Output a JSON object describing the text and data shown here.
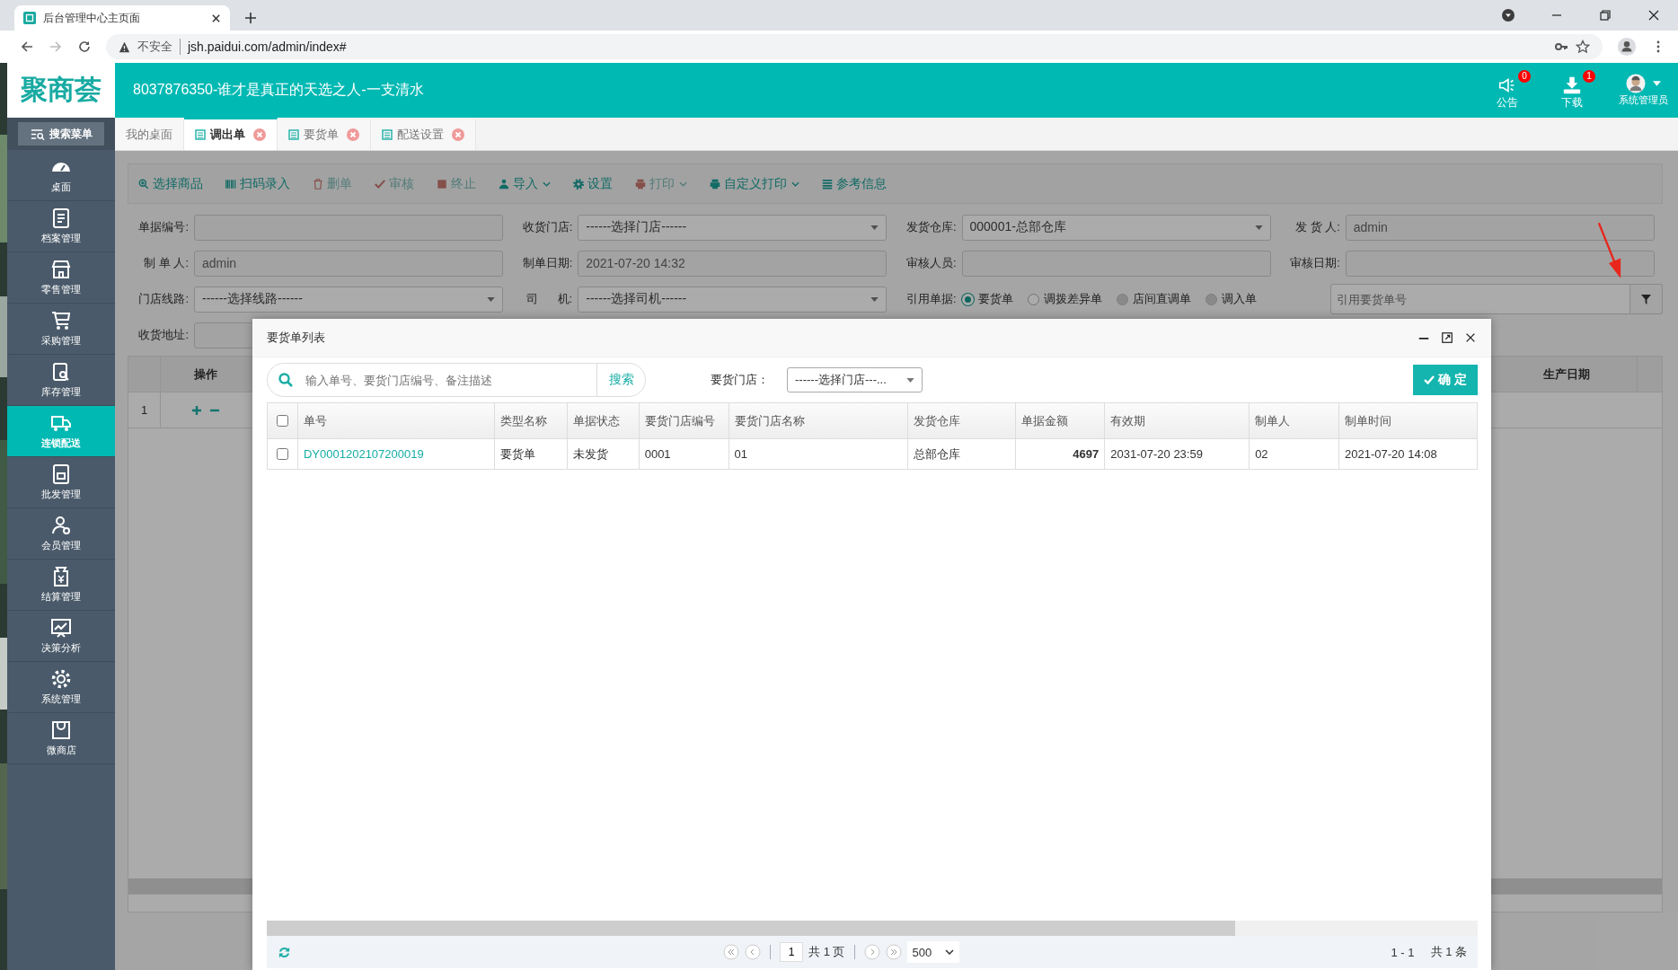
{
  "browser": {
    "tab_title": "后台管理中心主页面",
    "security": "不安全",
    "url": "jsh.paidui.com/admin/index#"
  },
  "header": {
    "logo": "聚商荟",
    "title": "8037876350-谁才是真正的天选之人-一支清水",
    "user": "系统管理员",
    "actions": [
      {
        "label": "公告",
        "badge": "0"
      },
      {
        "label": "下载",
        "badge": "1"
      }
    ]
  },
  "sidebar": {
    "search": "搜索菜单",
    "items": [
      {
        "label": "桌面",
        "selected": false
      },
      {
        "label": "档案管理",
        "selected": false
      },
      {
        "label": "零售管理",
        "selected": false
      },
      {
        "label": "采购管理",
        "selected": false
      },
      {
        "label": "库存管理",
        "selected": false
      },
      {
        "label": "连锁配送",
        "selected": true
      },
      {
        "label": "批发管理",
        "selected": false
      },
      {
        "label": "会员管理",
        "selected": false
      },
      {
        "label": "结算管理",
        "selected": false
      },
      {
        "label": "决策分析",
        "selected": false
      },
      {
        "label": "系统管理",
        "selected": false
      },
      {
        "label": "微商店",
        "selected": false
      }
    ]
  },
  "tabs": [
    {
      "label": "我的桌面",
      "selected": false,
      "closable": false
    },
    {
      "label": "调出单",
      "selected": true,
      "closable": true
    },
    {
      "label": "要货单",
      "selected": false,
      "closable": true
    },
    {
      "label": "配送设置",
      "selected": false,
      "closable": true
    }
  ],
  "toolbar": [
    {
      "label": "选择商品",
      "disabled": false,
      "dropdown": false
    },
    {
      "label": "扫码录入",
      "disabled": false,
      "dropdown": false
    },
    {
      "label": "删单",
      "disabled": true,
      "dropdown": false
    },
    {
      "label": "审核",
      "disabled": true,
      "dropdown": false
    },
    {
      "label": "终止",
      "disabled": true,
      "dropdown": false
    },
    {
      "label": "导入",
      "disabled": false,
      "dropdown": true
    },
    {
      "label": "设置",
      "disabled": false,
      "dropdown": false
    },
    {
      "label": "打印",
      "disabled": true,
      "dropdown": true
    },
    {
      "label": "自定义打印",
      "disabled": false,
      "dropdown": true
    },
    {
      "label": "参考信息",
      "disabled": false,
      "dropdown": false
    }
  ],
  "form": {
    "grid": [
      {
        "label": "单据编号:",
        "kind": "input"
      },
      {
        "label": "收货门店:",
        "kind": "select",
        "value": "------选择门店------"
      },
      {
        "label": "发货仓库:",
        "kind": "select",
        "value": "000001-总部仓库"
      },
      {
        "label": "发 货 人:",
        "kind": "input",
        "value": "admin"
      },
      {
        "label": "制 单 人:",
        "kind": "input",
        "value": "admin"
      },
      {
        "label": "制单日期:",
        "kind": "input",
        "value": "2021-07-20 14:32"
      },
      {
        "label": "审核人员:",
        "kind": "input"
      },
      {
        "label": "审核日期:",
        "kind": "input"
      },
      {
        "label": "门店线路:",
        "kind": "select",
        "value": "------选择线路------"
      },
      {
        "label": "司      机:",
        "kind": "select",
        "value": "------选择司机------"
      }
    ],
    "reference": {
      "label": "引用单据:",
      "placeholder": "引用要货单号",
      "options": [
        {
          "label": "要货单",
          "selected": true,
          "disabled": false
        },
        {
          "label": "调拨差异单",
          "selected": false,
          "disabled": false
        },
        {
          "label": "店间直调单",
          "selected": false,
          "disabled": true
        },
        {
          "label": "调入单",
          "selected": false,
          "disabled": true
        }
      ]
    },
    "address": {
      "label": "收货地址:"
    }
  },
  "table": {
    "columns": [
      "操作",
      "生产日期"
    ],
    "rows": [
      {
        "index": "1"
      }
    ]
  },
  "modal": {
    "title": "要货单列表",
    "search_placeholder": "输入单号、要货门店编号、备注描述",
    "search_button": "搜索",
    "store_label": "要货门店：",
    "store_value": "------选择门店---...",
    "confirm": "确 定",
    "all_checked": false,
    "columns": [
      "单号",
      "类型名称",
      "单据状态",
      "要货门店编号",
      "要货门店名称",
      "发货仓库",
      "单据金额",
      "有效期",
      "制单人",
      "制单时间"
    ],
    "rows": [
      {
        "checked": false,
        "cells": [
          "DY0001202107200019",
          "要货单",
          "未发货",
          "0001",
          "01",
          "总部仓库",
          "4697",
          "2031-07-20 23:59",
          "02",
          "2021-07-20 14:08"
        ]
      }
    ],
    "pager": {
      "page": "1",
      "total": "共 1 页",
      "size": "500",
      "range": "1 - 1",
      "count": "共 1 条"
    }
  }
}
